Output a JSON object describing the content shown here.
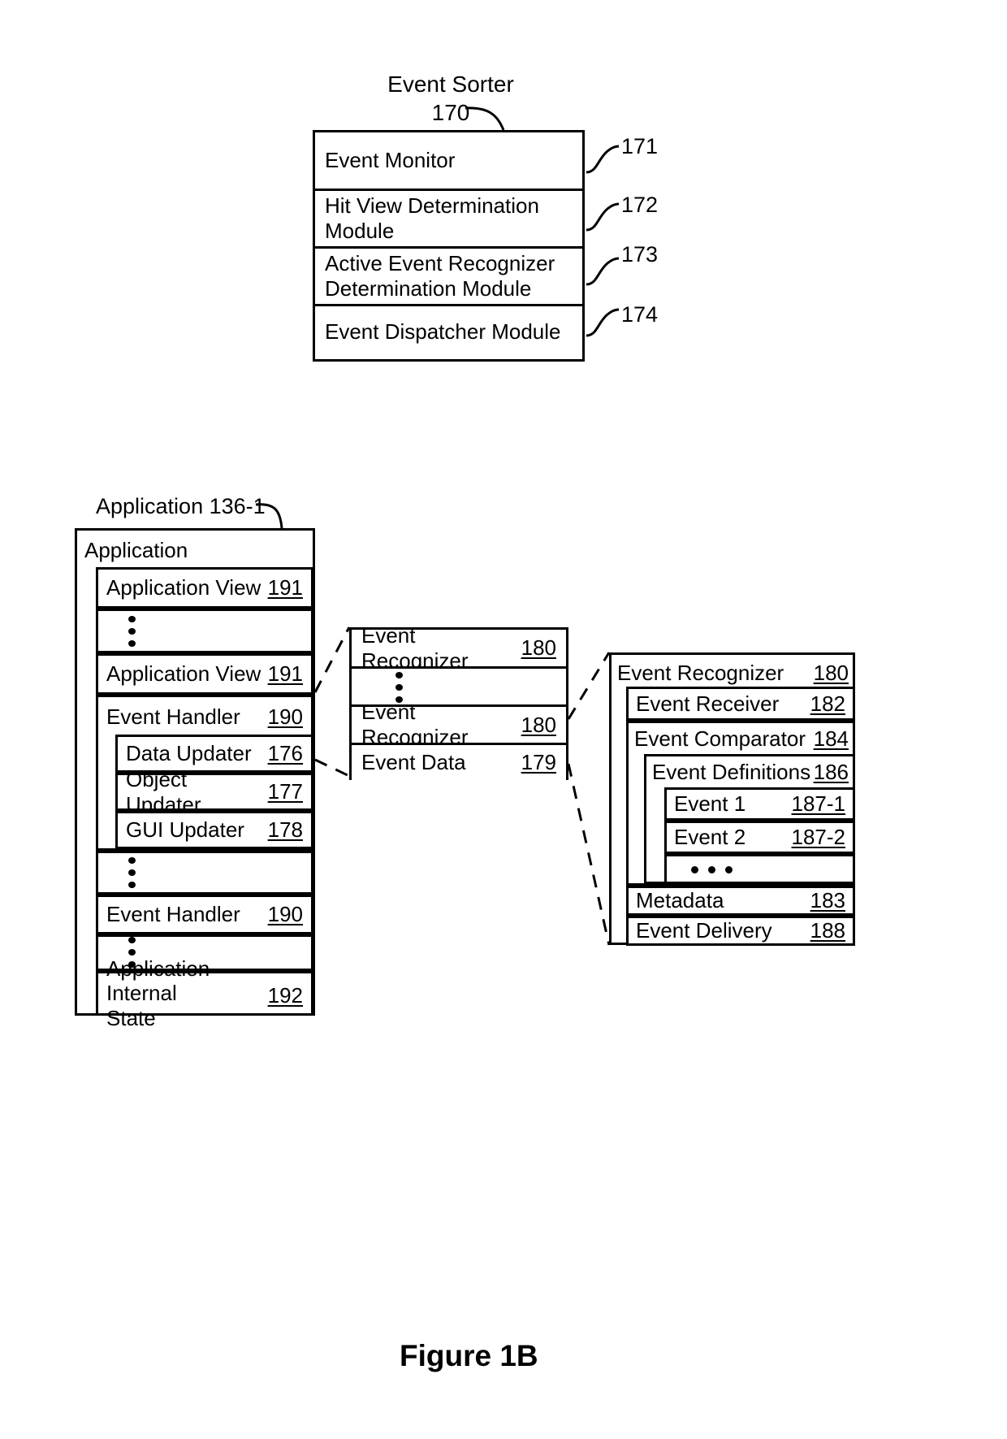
{
  "figure": {
    "caption": "Figure 1B"
  },
  "event_sorter": {
    "title_line1": "Event Sorter",
    "title_line2": "170",
    "rows": [
      {
        "label": "Event Monitor",
        "ref": "171"
      },
      {
        "label": "Hit View Determination\nModule",
        "ref": "172"
      },
      {
        "label": "Active Event Recognizer\nDetermination Module",
        "ref": "173"
      },
      {
        "label": "Event Dispatcher Module",
        "ref": "174"
      }
    ]
  },
  "application": {
    "callout": "Application 136-1",
    "header": "Application",
    "rows": [
      {
        "label": "Application View",
        "num": "191"
      },
      {
        "label": "Application View",
        "num": "191"
      },
      {
        "label": "Event Handler",
        "num": "190"
      },
      {
        "label": "Event Handler",
        "num": "190"
      },
      {
        "label": "Application Internal\nState",
        "num": "192"
      }
    ],
    "updaters": [
      {
        "label": "Data Updater",
        "num": "176"
      },
      {
        "label": "Object Updater",
        "num": "177"
      },
      {
        "label": "GUI Updater",
        "num": "178"
      }
    ]
  },
  "recognizer_list": {
    "rows": [
      {
        "label": "Event Recognizer",
        "num": "180"
      },
      {
        "label": "Event Recognizer",
        "num": "180"
      },
      {
        "label": "Event Data",
        "num": "179"
      }
    ]
  },
  "recognizer_detail": {
    "header": {
      "label": "Event Recognizer",
      "num": "180"
    },
    "receiver": {
      "label": "Event Receiver",
      "num": "182"
    },
    "comparator": {
      "label": "Event Comparator",
      "num": "184"
    },
    "definitions": {
      "label": "Event Definitions",
      "num": "186"
    },
    "events": [
      {
        "label": "Event 1",
        "num": "187-1"
      },
      {
        "label": "Event 2",
        "num": "187-2"
      }
    ],
    "footer_rows": [
      {
        "label": "Metadata",
        "num": "183"
      },
      {
        "label": "Event Delivery",
        "num": "188"
      }
    ]
  }
}
